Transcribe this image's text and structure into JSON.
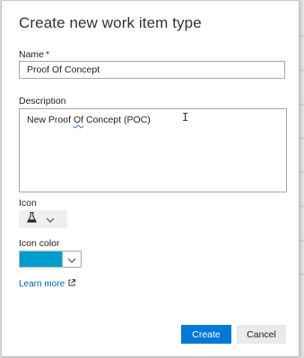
{
  "dialog": {
    "title": "Create new work item type",
    "name_label": "Name",
    "name_required_marker": "*",
    "name_value": "Proof Of Concept",
    "description_label": "Description",
    "description_value": {
      "before": "New Proof ",
      "misspelled": "Of",
      "after": " Concept (POC)"
    },
    "icon_label": "Icon",
    "icon_selected": "flask-icon",
    "icon_color_label": "Icon color",
    "icon_color_value": "#009ccc",
    "learn_more_label": "Learn more",
    "create_label": "Create",
    "cancel_label": "Cancel"
  },
  "colors": {
    "accent": "#0078d7",
    "link": "#0063b1",
    "required": "#cc0000"
  }
}
